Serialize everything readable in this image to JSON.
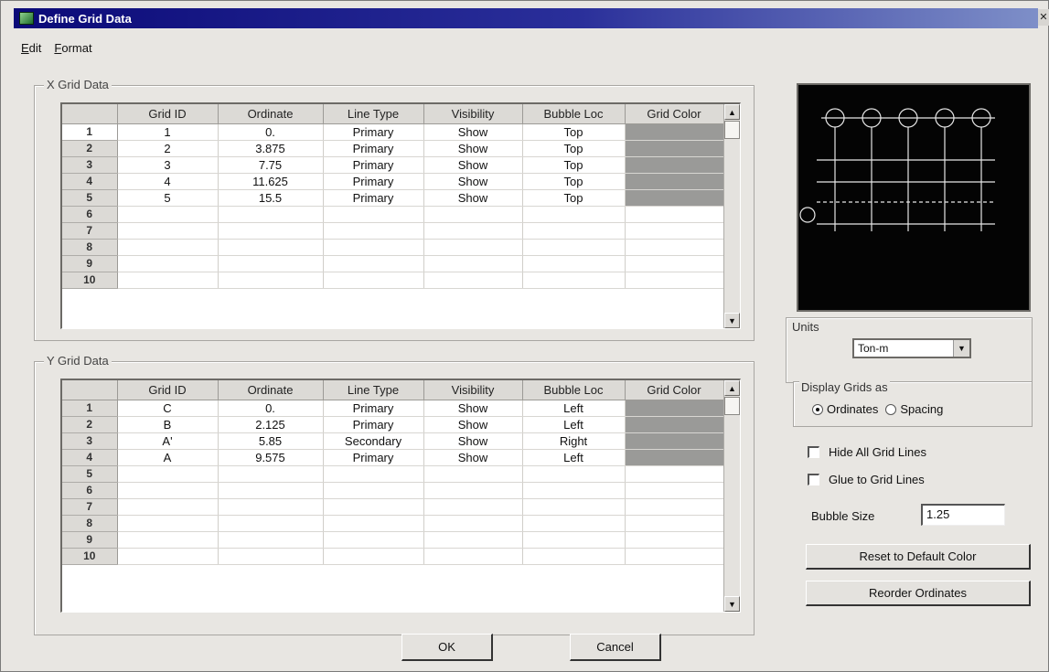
{
  "window": {
    "title": "Define Grid Data"
  },
  "menu": {
    "items": [
      "Edit",
      "Format"
    ]
  },
  "x_grid": {
    "label": "X Grid Data",
    "columns": [
      "Grid ID",
      "Ordinate",
      "Line Type",
      "Visibility",
      "Bubble Loc",
      "Grid Color"
    ],
    "row_numbers": [
      "1",
      "2",
      "3",
      "4",
      "5",
      "6",
      "7",
      "8",
      "9",
      "10"
    ],
    "rows": [
      [
        "1",
        "0.",
        "Primary",
        "Show",
        "Top"
      ],
      [
        "2",
        "3.875",
        "Primary",
        "Show",
        "Top"
      ],
      [
        "3",
        "7.75",
        "Primary",
        "Show",
        "Top"
      ],
      [
        "4",
        "11.625",
        "Primary",
        "Show",
        "Top"
      ],
      [
        "5",
        "15.5",
        "Primary",
        "Show",
        "Top"
      ]
    ]
  },
  "y_grid": {
    "label": "Y Grid Data",
    "columns": [
      "Grid ID",
      "Ordinate",
      "Line Type",
      "Visibility",
      "Bubble Loc",
      "Grid Color"
    ],
    "row_numbers": [
      "1",
      "2",
      "3",
      "4",
      "5",
      "6",
      "7",
      "8",
      "9",
      "10"
    ],
    "rows": [
      [
        "C",
        "0.",
        "Primary",
        "Show",
        "Left"
      ],
      [
        "B",
        "2.125",
        "Primary",
        "Show",
        "Left"
      ],
      [
        "A'",
        "5.85",
        "Secondary",
        "Show",
        "Right"
      ],
      [
        "A",
        "9.575",
        "Primary",
        "Show",
        "Left"
      ]
    ]
  },
  "units": {
    "label": "Units",
    "value": "Ton-m"
  },
  "display_grids": {
    "label": "Display Grids as",
    "options": [
      "Ordinates",
      "Spacing"
    ],
    "selected": "Ordinates"
  },
  "hide_all_grid_lines": {
    "label": "Hide All Grid Lines",
    "checked": false
  },
  "glue_to_grid_lines": {
    "label": "Glue to Grid Lines",
    "checked": false
  },
  "bubble_size": {
    "label": "Bubble Size",
    "value": "1.25"
  },
  "buttons": {
    "reset_color": "Reset to Default Color",
    "reorder": "Reorder Ordinates",
    "ok": "OK",
    "cancel": "Cancel"
  },
  "colors": {
    "title_bar": "#0b0a78",
    "grid_color_swatch": "#9a9a98",
    "preview_background": "#040404",
    "preview_lines": "#e6e6e6"
  }
}
